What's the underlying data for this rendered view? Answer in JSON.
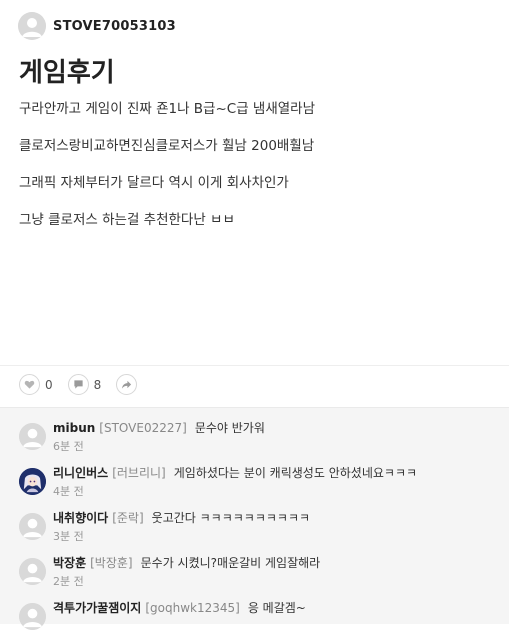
{
  "post": {
    "author": "STOVE70053103",
    "title": "게임후기",
    "lines": [
      "구라안까고 게임이 진짜 죤1나 B급~C급 냄새열라남",
      "클로저스랑비교하면진심클로저스가 훨남 200배훨남",
      "그래픽 자체부터가 달르다 역시 이게 회사차인가",
      "그냥 클로저스 하는걸 추천한다난 ㅂㅂ"
    ]
  },
  "actions": {
    "like_icon": "heart-icon",
    "like_count": "0",
    "comment_icon": "comment-bubble-icon",
    "comment_count": "8",
    "share_icon": "share-arrow-icon"
  },
  "comments": [
    {
      "name": "mibun",
      "tag": "[STOVE02227]",
      "text": "문수야 반가워",
      "time": "6분 전",
      "avatar": "default-avatar"
    },
    {
      "name": "리니인버스",
      "tag": "[러브리니]",
      "text": "게임하셨다는 분이 캐릭생성도 안하셨네요ㅋㅋㅋ",
      "time": "4분 전",
      "avatar": "anime-character-avatar"
    },
    {
      "name": "내취향이다",
      "tag": "[준락]",
      "text": "웃고간다 ㅋㅋㅋㅋㅋㅋㅋㅋㅋㅋ",
      "time": "3분 전",
      "avatar": "default-avatar"
    },
    {
      "name": "박장훈",
      "tag": "[박장훈]",
      "text": "문수가 시켰니?매운갈비 게임잘해라",
      "time": "2분 전",
      "avatar": "default-avatar"
    },
    {
      "name": "격투가가꿀잼이지",
      "tag": "[goqhwk12345]",
      "text": "응 메갈겜~",
      "time": "",
      "avatar": "default-avatar"
    }
  ],
  "colors": {
    "avatar_bg": "#d9d9d9",
    "comment_bg": "#f5f5f5",
    "tag_color": "#888888",
    "anime_avatar_bg": "#1f2f6b"
  }
}
